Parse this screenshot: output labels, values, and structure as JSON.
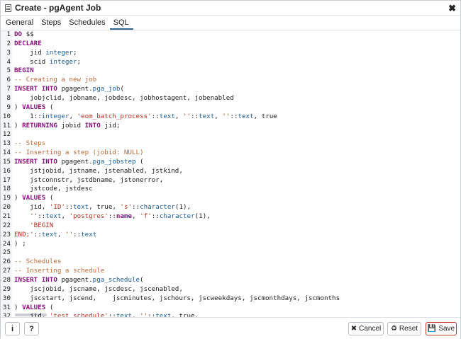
{
  "window": {
    "title": "Create - pgAgent Job",
    "close_icon": "✖"
  },
  "tabs": [
    {
      "label": "General",
      "active": false
    },
    {
      "label": "Steps",
      "active": false
    },
    {
      "label": "Schedules",
      "active": false
    },
    {
      "label": "SQL",
      "active": true
    }
  ],
  "editor": {
    "lines": [
      {
        "n": "1",
        "tokens": [
          [
            "kw",
            "DO"
          ],
          [
            "p",
            " $$"
          ]
        ]
      },
      {
        "n": "2",
        "tokens": [
          [
            "kw",
            "DECLARE"
          ]
        ]
      },
      {
        "n": "3",
        "tokens": [
          [
            "p",
            "    jid "
          ],
          [
            "tp",
            "integer"
          ],
          [
            "p",
            ";"
          ]
        ]
      },
      {
        "n": "4",
        "tokens": [
          [
            "p",
            "    scid "
          ],
          [
            "tp",
            "integer"
          ],
          [
            "p",
            ";"
          ]
        ]
      },
      {
        "n": "5",
        "tokens": [
          [
            "kw",
            "BEGIN"
          ]
        ]
      },
      {
        "n": "6",
        "tokens": [
          [
            "cm",
            "-- Creating a new job"
          ]
        ]
      },
      {
        "n": "7",
        "tokens": [
          [
            "kw",
            "INSERT INTO"
          ],
          [
            "p",
            " pgagent."
          ],
          [
            "fn",
            "pga_job"
          ],
          [
            "p",
            "("
          ]
        ]
      },
      {
        "n": "8",
        "tokens": [
          [
            "p",
            "    jobjclid, jobname, jobdesc, jobhostagent, jobenabled"
          ]
        ]
      },
      {
        "n": "9",
        "tokens": [
          [
            "p",
            ") "
          ],
          [
            "kw",
            "VALUES"
          ],
          [
            "p",
            " ("
          ]
        ]
      },
      {
        "n": "10",
        "tokens": [
          [
            "p",
            "    1::"
          ],
          [
            "tp",
            "integer"
          ],
          [
            "p",
            ", "
          ],
          [
            "st",
            "'eom_batch_process'"
          ],
          [
            "p",
            "::"
          ],
          [
            "tp",
            "text"
          ],
          [
            "p",
            ", "
          ],
          [
            "st",
            "''"
          ],
          [
            "p",
            "::"
          ],
          [
            "tp",
            "text"
          ],
          [
            "p",
            ", "
          ],
          [
            "st",
            "''"
          ],
          [
            "p",
            "::"
          ],
          [
            "tp",
            "text"
          ],
          [
            "p",
            ", true"
          ]
        ]
      },
      {
        "n": "11",
        "tokens": [
          [
            "p",
            ") "
          ],
          [
            "kw",
            "RETURNING"
          ],
          [
            "p",
            " jobid "
          ],
          [
            "kw",
            "INTO"
          ],
          [
            "p",
            " jid;"
          ]
        ]
      },
      {
        "n": "12",
        "tokens": []
      },
      {
        "n": "13",
        "tokens": [
          [
            "cm",
            "-- Steps"
          ]
        ]
      },
      {
        "n": "14",
        "tokens": [
          [
            "cm",
            "-- Inserting a step (jobid: NULL)"
          ]
        ]
      },
      {
        "n": "15",
        "tokens": [
          [
            "kw",
            "INSERT INTO"
          ],
          [
            "p",
            " pgagent."
          ],
          [
            "fn",
            "pga_jobstep"
          ],
          [
            "p",
            " ("
          ]
        ]
      },
      {
        "n": "16",
        "tokens": [
          [
            "p",
            "    jstjobid, jstname, jstenabled, jstkind,"
          ]
        ]
      },
      {
        "n": "17",
        "tokens": [
          [
            "p",
            "    jstconnstr, jstdbname, jstonerror,"
          ]
        ]
      },
      {
        "n": "18",
        "tokens": [
          [
            "p",
            "    jstcode, jstdesc"
          ]
        ]
      },
      {
        "n": "19",
        "tokens": [
          [
            "p",
            ") "
          ],
          [
            "kw",
            "VALUES"
          ],
          [
            "p",
            " ("
          ]
        ]
      },
      {
        "n": "20",
        "tokens": [
          [
            "p",
            "    jid, "
          ],
          [
            "st",
            "'ID'"
          ],
          [
            "p",
            "::"
          ],
          [
            "tp",
            "text"
          ],
          [
            "p",
            ", true, "
          ],
          [
            "st",
            "'s'"
          ],
          [
            "p",
            "::"
          ],
          [
            "tp",
            "character"
          ],
          [
            "p",
            "(1),"
          ]
        ]
      },
      {
        "n": "21",
        "tokens": [
          [
            "p",
            "    "
          ],
          [
            "st",
            "''"
          ],
          [
            "p",
            "::"
          ],
          [
            "tp",
            "text"
          ],
          [
            "p",
            ", "
          ],
          [
            "st",
            "'postgres'"
          ],
          [
            "p",
            "::"
          ],
          [
            "kw",
            "name"
          ],
          [
            "p",
            ", "
          ],
          [
            "st",
            "'f'"
          ],
          [
            "p",
            "::"
          ],
          [
            "tp",
            "character"
          ],
          [
            "p",
            "(1),"
          ]
        ]
      },
      {
        "n": "22",
        "tokens": [
          [
            "p",
            "    "
          ],
          [
            "st",
            "'BEGIN"
          ]
        ]
      },
      {
        "n": "23",
        "tokens": [
          [
            "st",
            "END;'"
          ],
          [
            "p",
            "::"
          ],
          [
            "tp",
            "text"
          ],
          [
            "p",
            ", "
          ],
          [
            "st",
            "''"
          ],
          [
            "p",
            "::"
          ],
          [
            "tp",
            "text"
          ]
        ]
      },
      {
        "n": "24",
        "tokens": [
          [
            "p",
            ") ;"
          ]
        ]
      },
      {
        "n": "25",
        "tokens": []
      },
      {
        "n": "26",
        "tokens": [
          [
            "cm",
            "-- Schedules"
          ]
        ]
      },
      {
        "n": "27",
        "tokens": [
          [
            "cm",
            "-- Inserting a schedule"
          ]
        ]
      },
      {
        "n": "28",
        "tokens": [
          [
            "kw",
            "INSERT INTO"
          ],
          [
            "p",
            " pgagent."
          ],
          [
            "fn",
            "pga_schedule"
          ],
          [
            "p",
            "("
          ]
        ]
      },
      {
        "n": "29",
        "tokens": [
          [
            "p",
            "    jscjobid, jscname, jscdesc, jscenabled,"
          ]
        ]
      },
      {
        "n": "30",
        "tokens": [
          [
            "p",
            "    jscstart, jscend,    jscminutes, jschours, jscweekdays, jscmonthdays, jscmonths"
          ]
        ]
      },
      {
        "n": "31",
        "tokens": [
          [
            "p",
            ") "
          ],
          [
            "kw",
            "VALUES"
          ],
          [
            "p",
            " ("
          ]
        ]
      },
      {
        "n": "32",
        "tokens": [
          [
            "p",
            "    jid, "
          ],
          [
            "st",
            "'test schedule'"
          ],
          [
            "p",
            "::"
          ],
          [
            "tp",
            "text"
          ],
          [
            "p",
            ", "
          ],
          [
            "st",
            "''"
          ],
          [
            "p",
            "::"
          ],
          [
            "tp",
            "text"
          ],
          [
            "p",
            ", true,"
          ]
        ]
      }
    ]
  },
  "footer": {
    "info_icon": "i",
    "help_icon": "?",
    "cancel_label": "Cancel",
    "reset_label": "Reset",
    "save_label": "Save"
  }
}
